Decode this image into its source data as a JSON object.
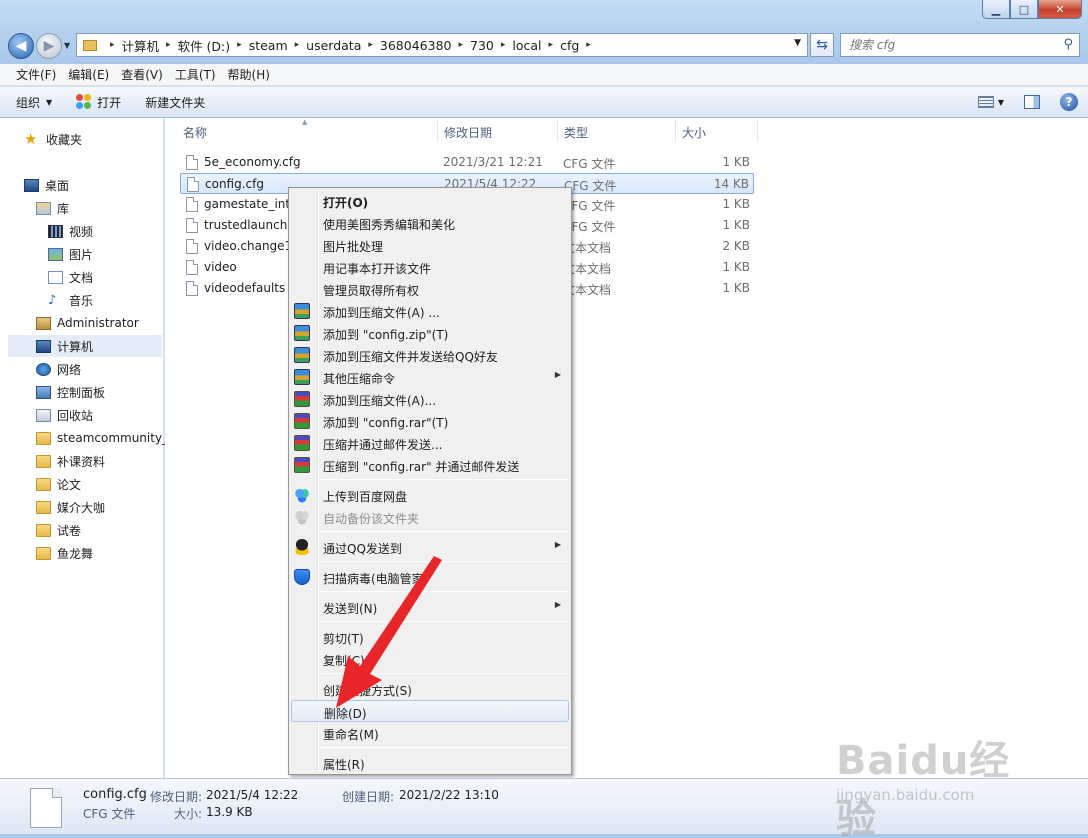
{
  "window": {
    "minimize": "▁",
    "maximize": "□",
    "close": "✕"
  },
  "address": {
    "crumbs": [
      "计算机",
      "软件 (D:)",
      "steam",
      "userdata",
      "368046380",
      "730",
      "local",
      "cfg"
    ],
    "search_placeholder": "搜索 cfg"
  },
  "menubar": [
    "文件(F)",
    "编辑(E)",
    "查看(V)",
    "工具(T)",
    "帮助(H)"
  ],
  "toolbar": {
    "organize": "组织",
    "open": "打开",
    "new_folder": "新建文件夹"
  },
  "nav": {
    "favorites": "收藏夹",
    "desktop": "桌面",
    "libraries": "库",
    "videos": "视频",
    "pictures": "图片",
    "documents": "文档",
    "music": "音乐",
    "administrator": "Administrator",
    "computer": "计算机",
    "network": "网络",
    "control_panel": "控制面板",
    "recycle_bin": "回收站",
    "folders": [
      "steamcommunity_3",
      "补课资料",
      "论文",
      "媒介大咖",
      "试卷",
      "鱼龙舞"
    ]
  },
  "columns": {
    "name": "名称",
    "date": "修改日期",
    "type": "类型",
    "size": "大小"
  },
  "files": [
    {
      "name": "5e_economy.cfg",
      "date": "2021/3/21 12:21",
      "type": "CFG 文件",
      "size": "1 KB"
    },
    {
      "name": "config.cfg",
      "date": "2021/5/4 12:22",
      "type": "CFG 文件",
      "size": "14 KB"
    },
    {
      "name": "gamestate_integration_5e.cfg",
      "date": "",
      "type": "CFG 文件",
      "size": "1 KB"
    },
    {
      "name": "trustedlaunch.cfg",
      "date": "",
      "type": "CFG 文件",
      "size": "1 KB"
    },
    {
      "name": "video.change1",
      "date": "",
      "type": "文本文档",
      "size": "2 KB"
    },
    {
      "name": "video",
      "date": "",
      "type": "文本文档",
      "size": "1 KB"
    },
    {
      "name": "videodefaults",
      "date": "",
      "type": "文本文档",
      "size": "1 KB"
    }
  ],
  "context_menu": {
    "open": "打开(O)",
    "meitu": "使用美图秀秀编辑和美化",
    "batch": "图片批处理",
    "notepad": "用记事本打开该文件",
    "admin": "管理员取得所有权",
    "add_archive_zip": "添加到压缩文件(A) ...",
    "add_config_zip": "添加到 \"config.zip\"(T)",
    "add_send_qq": "添加到压缩文件并发送给QQ好友",
    "other_zip": "其他压缩命令",
    "add_archive_rar": "添加到压缩文件(A)...",
    "add_config_rar": "添加到 \"config.rar\"(T)",
    "compress_email": "压缩并通过邮件发送...",
    "compress_rar_email": "压缩到 \"config.rar\" 并通过邮件发送",
    "baidu_upload": "上传到百度网盘",
    "baidu_backup": "自动备份该文件夹",
    "qq_send": "通过QQ发送到",
    "scan": "扫描病毒(电脑管家)",
    "send_to": "发送到(N)",
    "cut": "剪切(T)",
    "copy": "复制(C)",
    "shortcut": "创建快捷方式(S)",
    "delete": "删除(D)",
    "rename": "重命名(M)",
    "properties": "属性(R)"
  },
  "details": {
    "filename": "config.cfg",
    "filetype": "CFG 文件",
    "modified_label": "修改日期:",
    "modified_value": "2021/5/4 12:22",
    "size_label": "大小:",
    "size_value": "13.9 KB",
    "created_label": "创建日期:",
    "created_value": "2021/2/22 13:10"
  },
  "watermark": {
    "logo": "Baidu经验",
    "url": "jingyan.baidu.com"
  },
  "icons": {
    "back": "arrow-left-icon",
    "forward": "arrow-right-icon",
    "refresh": "refresh-icon",
    "search": "magnifier-icon",
    "help": "help-icon",
    "submenu": "triangle-right-icon"
  }
}
